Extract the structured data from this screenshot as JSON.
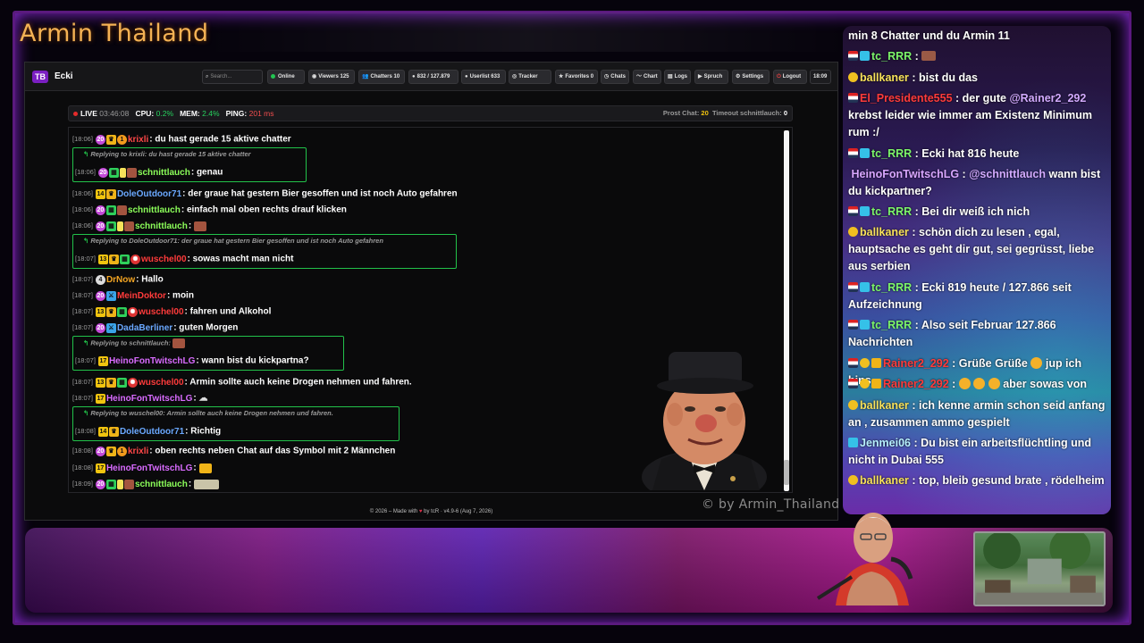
{
  "stream": {
    "title": "Armin Thailand",
    "watermark": "© by Armin_Thailand"
  },
  "app": {
    "logo": "TB",
    "name": "Ecki",
    "toolbar": {
      "search_placeholder": "Search...",
      "online": "Online",
      "viewers": "Viewers 125",
      "chatters": "Chatters 10",
      "messages": "832 / 127.879",
      "userlist": "Userlist 633",
      "tracker": "Tracker",
      "favorites": "Favorites 0",
      "chats": "Chats",
      "chart": "Chart",
      "logs": "Logs",
      "spruch": "Spruch",
      "settings": "Settings",
      "logout": "Logout",
      "time": "18:09"
    },
    "status": {
      "live_label": "LIVE",
      "live_time": "03:46:08",
      "cpu_label": "CPU:",
      "cpu": "0.2%",
      "mem_label": "MEM:",
      "mem": "2.4%",
      "ping_label": "PING:",
      "ping": "201 ms",
      "prost_label": "Prost Chat:",
      "prost": "20",
      "timeout_label": "Timeout schnittlauch:",
      "timeout": "0"
    },
    "chat": [
      {
        "time": "[18:06]",
        "user": "krixli",
        "text": "du hast gerade 15 aktive chatter"
      },
      {
        "reply": "Replying to krixli: du hast gerade 15 aktive chatter",
        "time": "[18:06]",
        "user": "schnittlauch",
        "text": "genau"
      },
      {
        "time": "[18:06]",
        "user": "DoleOutdoor71",
        "text": "der graue hat gestern Bier gesoffen und ist noch Auto gefahren"
      },
      {
        "time": "[18:06]",
        "user": "schnittlauch",
        "text": "einfach mal oben rechts drauf klicken"
      },
      {
        "time": "[18:06]",
        "user": "schnittlauch",
        "text": ""
      },
      {
        "reply": "Replying to DoleOutdoor71: der graue hat gestern Bier gesoffen und ist noch Auto gefahren",
        "time": "[18:07]",
        "user": "wuschel00",
        "text": "sowas macht man nicht"
      },
      {
        "time": "[18:07]",
        "user": "DrNow",
        "text": "Hallo"
      },
      {
        "time": "[18:07]",
        "user": "MeinDoktor",
        "text": "moin"
      },
      {
        "time": "[18:07]",
        "user": "wuschel00",
        "text": "fahren und Alkohol"
      },
      {
        "time": "[18:07]",
        "user": "DadaBerliner",
        "text": "guten Morgen"
      },
      {
        "reply": "Replying to schnittlauch:",
        "time": "[18:07]",
        "user": "HeinoFonTwitschLG",
        "text": "wann bist du kickpartna?"
      },
      {
        "time": "[18:07]",
        "user": "wuschel00",
        "text": "Armin sollte auch keine Drogen nehmen und fahren."
      },
      {
        "time": "[18:07]",
        "user": "HeinoFonTwitschLG",
        "text": ""
      },
      {
        "reply": "Replying to wuschel00: Armin sollte auch keine Drogen nehmen und fahren.",
        "time": "[18:08]",
        "user": "DoleOutdoor71",
        "text": "Richtig"
      },
      {
        "time": "[18:08]",
        "user": "krixli",
        "text": "oben rechts neben Chat auf das Symbol mit 2 Männchen"
      },
      {
        "time": "[18:08]",
        "user": "HeinoFonTwitschLG",
        "text": ""
      },
      {
        "time": "[18:09]",
        "user": "schnittlauch",
        "text": ""
      }
    ],
    "footer": {
      "pre": "© 2026 – Made with",
      "post": "by tcR · v4.9-6 (Aug 7, 2026)"
    }
  },
  "stream_chat": [
    {
      "user": "",
      "text": "min 8 Chatter und du Armin 11"
    },
    {
      "user": "tc_RRR",
      "text": ""
    },
    {
      "user": "ballkaner",
      "text": "bist du das"
    },
    {
      "user": "El_Presidente555",
      "mention": "@Rainer2_292",
      "text": "der gute",
      "text2": "krebst leider wie immer am Existenz Minimum rum :/"
    },
    {
      "user": "tc_RRR",
      "text": "Ecki hat 816 heute"
    },
    {
      "user": "HeinoFonTwitschLG",
      "mention": "@schnittlauch",
      "text": "wann bist du kickpartner?"
    },
    {
      "user": "tc_RRR",
      "text": "Bei dir weiß ich nich"
    },
    {
      "user": "ballkaner",
      "text": "schön dich zu lesen , egal, hauptsache es geht dir gut, sei gegrüsst, liebe aus serbien"
    },
    {
      "user": "tc_RRR",
      "text": "Ecki 819 heute / 127.866 seit Aufzeichnung"
    },
    {
      "user": "tc_RRR",
      "text": "Also seit Februar 127.866 Nachrichten"
    },
    {
      "user": "Rainer2_292",
      "text": "Grüße Grüße",
      "text2": "jup ich bins"
    },
    {
      "user": "Rainer2_292",
      "text": "aber sowas von"
    },
    {
      "user": "ballkaner",
      "text": "ich kenne armin schon seid anfang an , zusammen ammo gespielt"
    },
    {
      "user": "Jenmei06",
      "text": "Du bist ein arbeitsflüchtling und nicht in Dubai 555"
    },
    {
      "user": "ballkaner",
      "text": "top, bleib gesund brate , rödelheim"
    }
  ],
  "colors": {
    "accent": "#7b1fc2",
    "reply_border": "#22c24a",
    "live": "#e52b2b",
    "tc_RRR": "#7cf56a",
    "ballkaner": "#f7e15a",
    "Rainer2_292": "#ff3b3b"
  }
}
